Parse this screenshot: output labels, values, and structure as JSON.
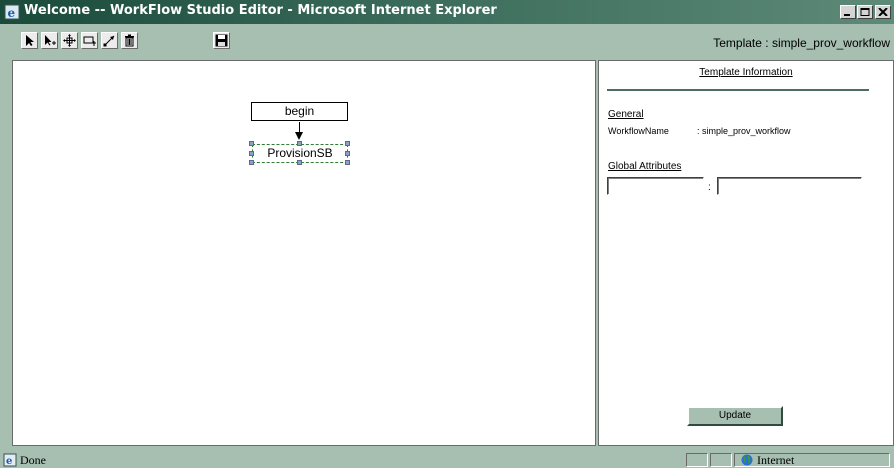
{
  "window": {
    "title": "Welcome -- WorkFlow Studio Editor - Microsoft Internet Explorer"
  },
  "toolbar": {
    "tools": [
      {
        "icon": "select-arrow-icon"
      },
      {
        "icon": "add-node-arrow-icon"
      },
      {
        "icon": "move-icon"
      },
      {
        "icon": "add-activity-icon"
      },
      {
        "icon": "connect-icon"
      },
      {
        "icon": "delete-icon"
      },
      {
        "icon": "save-icon"
      }
    ],
    "template_label": "Template : simple_prov_workflow"
  },
  "canvas": {
    "nodes": [
      {
        "id": "begin",
        "label": "begin"
      },
      {
        "id": "provision",
        "label": "ProvisionSB"
      }
    ]
  },
  "info": {
    "heading": "Template Information",
    "general_heading": "General",
    "workflow_name_label": "WorkflowName",
    "workflow_name_value": ": simple_prov_workflow",
    "global_attrs_heading": "Global Attributes",
    "attr_key_value": "",
    "attr_value_value": "",
    "colon": ":",
    "update_label": "Update"
  },
  "statusbar": {
    "status": "Done",
    "zone": "Internet"
  },
  "colors": {
    "title_bar": "#1a4a3a",
    "chrome": "#a6bfb1",
    "selection": "#2e7d32"
  }
}
